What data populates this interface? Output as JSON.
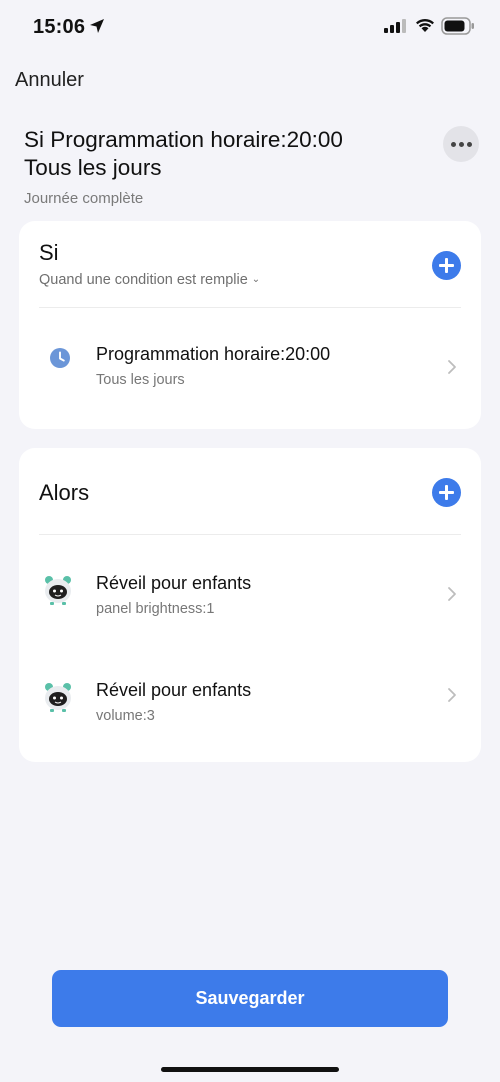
{
  "status_bar": {
    "time": "15:06"
  },
  "nav": {
    "cancel_label": "Annuler"
  },
  "header": {
    "title_line1": "Si Programmation horaire:20:00",
    "title_line2": "Tous les jours",
    "subtitle": "Journée complète"
  },
  "if_section": {
    "title": "Si",
    "condition_label": "Quand une condition est remplie",
    "items": [
      {
        "title": "Programmation horaire:20:00",
        "subtitle": "Tous les jours",
        "icon": "clock-icon"
      }
    ]
  },
  "then_section": {
    "title": "Alors",
    "items": [
      {
        "title": "Réveil pour enfants",
        "subtitle": "panel brightness:1",
        "icon": "kids-alarm-clock-icon"
      },
      {
        "title": "Réveil pour enfants",
        "subtitle": "volume:3",
        "icon": "kids-alarm-clock-icon"
      }
    ]
  },
  "footer": {
    "save_label": "Sauvegarder"
  },
  "colors": {
    "accent": "#3d7bea",
    "background": "#f4f4f9",
    "card": "#ffffff"
  }
}
